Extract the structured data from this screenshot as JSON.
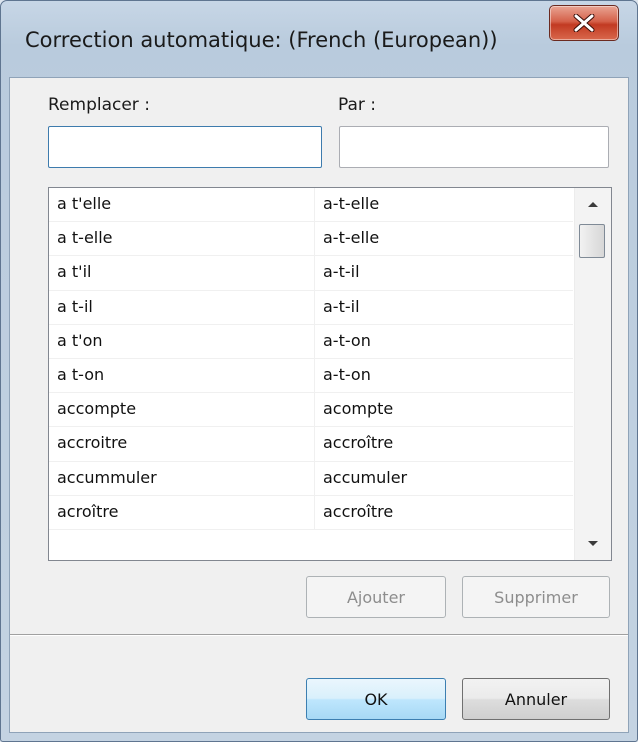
{
  "window": {
    "title": "Correction automatique: (French (European))",
    "close_icon": "close-x-icon"
  },
  "form": {
    "replace_label": "Remplacer :",
    "with_label": "Par :",
    "replace_value": "",
    "with_value": ""
  },
  "list": {
    "rows": [
      {
        "from": "a t'elle",
        "to": "a-t-elle"
      },
      {
        "from": "a t-elle",
        "to": "a-t-elle"
      },
      {
        "from": "a t'il",
        "to": "a-t-il"
      },
      {
        "from": "a t-il",
        "to": "a-t-il"
      },
      {
        "from": "a t'on",
        "to": "a-t-on"
      },
      {
        "from": "a t-on",
        "to": "a-t-on"
      },
      {
        "from": "accompte",
        "to": "acompte"
      },
      {
        "from": "accroitre",
        "to": "accroître"
      },
      {
        "from": "accummuler",
        "to": "accumuler"
      },
      {
        "from": "acroître",
        "to": "accroître"
      }
    ],
    "scroll_up_icon": "scroll-up-arrow-icon",
    "scroll_down_icon": "scroll-down-arrow-icon"
  },
  "buttons": {
    "add": "Ajouter",
    "delete": "Supprimer",
    "ok": "OK",
    "cancel": "Annuler"
  },
  "colors": {
    "close_button": "#c9452b",
    "default_button_border": "#3c7fb1",
    "focused_field_border": "#3d7bad"
  }
}
